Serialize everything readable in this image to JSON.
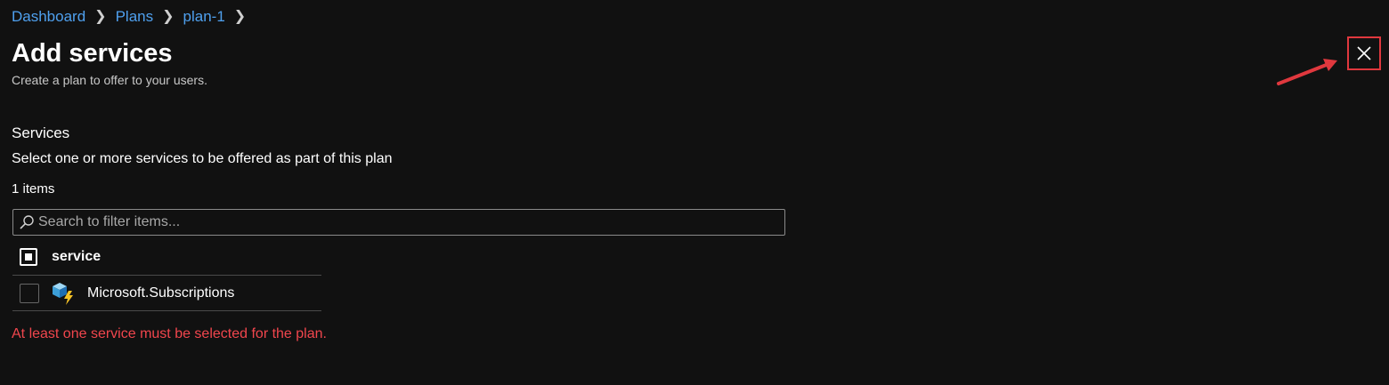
{
  "breadcrumb": {
    "items": [
      "Dashboard",
      "Plans",
      "plan-1"
    ]
  },
  "header": {
    "title": "Add services",
    "subtitle": "Create a plan to offer to your users."
  },
  "services": {
    "label": "Services",
    "description": "Select one or more services to be offered as part of this plan",
    "item_count": "1 items",
    "filter_placeholder": "Search to filter items...",
    "column_header": "service",
    "rows": [
      {
        "name": "Microsoft.Subscriptions",
        "icon": "subscription-service-icon",
        "checked": false
      }
    ],
    "error": "At least one service must be selected for the plan."
  },
  "colors": {
    "background": "#111111",
    "link": "#4fa0ee",
    "error": "#f1464d",
    "highlight": "#e0383e"
  },
  "icons": {
    "close": "close-icon",
    "search": "search-icon",
    "chevron": "chevron-right-icon"
  }
}
